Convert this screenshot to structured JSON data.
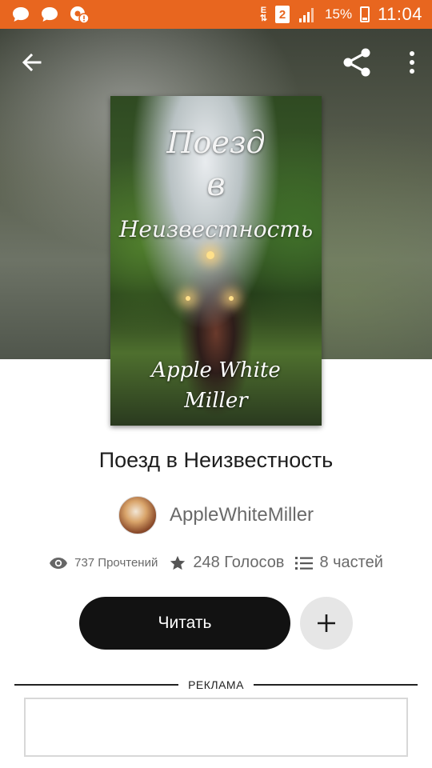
{
  "status_bar": {
    "time": "11:04",
    "battery_percent": "15%",
    "sim_slot": "2",
    "network_type": "E",
    "notification_icons": [
      "chat-bubble-icon",
      "chat-bubble-icon",
      "settings-alert-icon"
    ],
    "background_color": "#e8661f"
  },
  "toolbar": {
    "back_icon": "arrow-left-icon",
    "share_icon": "share-icon",
    "menu_icon": "more-vertical-icon"
  },
  "cover": {
    "title_line1": "Поезд",
    "title_line2": "в",
    "title_line3": "Неизвестность",
    "author_line1": "Apple  White",
    "author_line2": "Miller"
  },
  "story": {
    "title": "Поезд в Неизвестность",
    "author": "AppleWhiteMiller"
  },
  "stats": {
    "reads": "737 Прочтений",
    "votes": "248 Голосов",
    "parts": "8 частей"
  },
  "actions": {
    "read_label": "Читать",
    "add_icon": "plus-icon"
  },
  "ad": {
    "label": "РЕКЛАМА"
  }
}
